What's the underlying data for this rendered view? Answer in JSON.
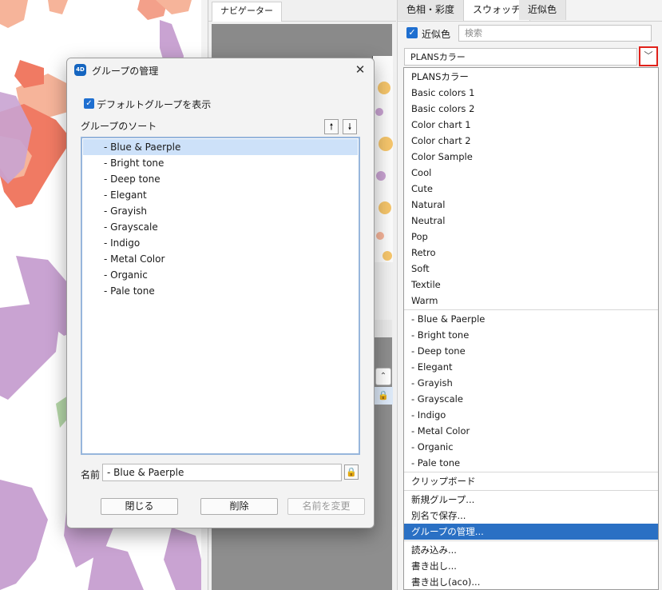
{
  "navigator": {
    "tab_label": "ナビゲーター"
  },
  "palette": {
    "tabs": [
      "色相・彩度",
      "スウォッチ",
      "近似色"
    ],
    "active_tab": "スウォッチ",
    "near_color_label": "近似色",
    "near_color_checked": true,
    "search_placeholder": "検索",
    "selected_set": "PLANSカラー",
    "dropdown_items_top": [
      "PLANSカラー",
      "Basic colors 1",
      "Basic colors 2",
      "Color chart 1",
      "Color chart 2",
      "Color Sample",
      "Cool",
      "Cute",
      "Natural",
      "Neutral",
      "Pop",
      "Retro",
      "Soft",
      "Textile",
      "Warm"
    ],
    "dropdown_items_groups": [
      "- Blue & Paerple",
      "- Bright tone",
      "- Deep tone",
      "- Elegant",
      "- Grayish",
      "- Grayscale",
      "- Indigo",
      "- Metal Color",
      "- Organic",
      "- Pale tone"
    ],
    "dropdown_clipboard": "クリップボード",
    "dropdown_actions": [
      "新規グループ...",
      "別名で保存...",
      "グループの管理..."
    ],
    "highlighted_action": "グループの管理...",
    "dropdown_io": [
      "読み込み...",
      "書き出し...",
      "書き出し(aco)..."
    ]
  },
  "dialog": {
    "logo_text": "4D",
    "title": "グループの管理",
    "close_glyph": "✕",
    "show_default_label": "デフォルトグループを表示",
    "show_default_checked": true,
    "sort_label": "グループのソート",
    "sort_up_glyph": "🠕",
    "sort_down_glyph": "🠗",
    "groups": [
      "- Blue & Paerple",
      "- Bright tone",
      "- Deep tone",
      "- Elegant",
      "- Grayish",
      "- Grayscale",
      "- Indigo",
      "- Metal Color",
      "- Organic",
      "- Pale tone"
    ],
    "selected_group": "- Blue & Paerple",
    "name_label": "名前",
    "name_value": "- Blue & Paerple",
    "buttons": {
      "close": "閉じる",
      "delete": "削除",
      "rename": "名前を変更"
    }
  },
  "icons": {
    "checkbox": "check-icon",
    "dropdown": "chevron-down-icon",
    "lock": "lock-icon",
    "close": "close-icon"
  },
  "colors": {
    "accent": "#2a70c4",
    "highlight_box": "#e0211a",
    "selection": "#cde1f9",
    "coral": "#f07a63",
    "salmon": "#f6b49a",
    "lavender": "#c9a3d2",
    "green": "#b5d7a8"
  }
}
